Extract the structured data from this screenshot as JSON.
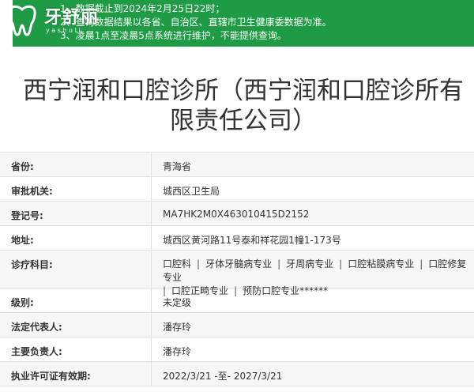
{
  "notice": {
    "line1": "1、数据截止到2024年2月25日22时；",
    "line2": "2、查询数据结果以各省、自治区、直辖市卫生健康委数据为准。",
    "line3": "3、凌晨1点至凌晨5点系统进行维护，不能提供查询。"
  },
  "logo": {
    "name": "牙舒丽",
    "sub": "y a s h u l i"
  },
  "title": "西宁润和口腔诊所（西宁润和口腔诊所有限责任公司）",
  "rows": {
    "province": {
      "label": "省份:",
      "value": "青海省"
    },
    "authority": {
      "label": "审批机关:",
      "value": "城西区卫生局"
    },
    "reg_no": {
      "label": "登记号:",
      "value": "MA7HK2M0X463010415D2152"
    },
    "address": {
      "label": "地址:",
      "value": "城西区黄河路11号泰和祥花园1幢1-173号"
    },
    "departments": {
      "label": "诊疗科目:",
      "items": [
        "口腔科",
        "牙体牙髓病专业",
        "牙周病专业",
        "口腔粘膜病专业",
        "口腔修复专业",
        "口腔正畸专业",
        "预防口腔专业******"
      ]
    },
    "level": {
      "label": "级别:",
      "value": "未定级"
    },
    "legal_rep": {
      "label": "法定代表人:",
      "value": "潘存玲"
    },
    "principal": {
      "label": "主要负责人:",
      "value": "潘存玲"
    },
    "license_valid": {
      "label": "执业许可证有效期:",
      "value": "2022/3/21 -至- 2027/3/21"
    }
  },
  "colors": {
    "notice_bg": "#1f9a45",
    "row_alt": "#f6f6f6",
    "border": "#e1e1e1"
  }
}
